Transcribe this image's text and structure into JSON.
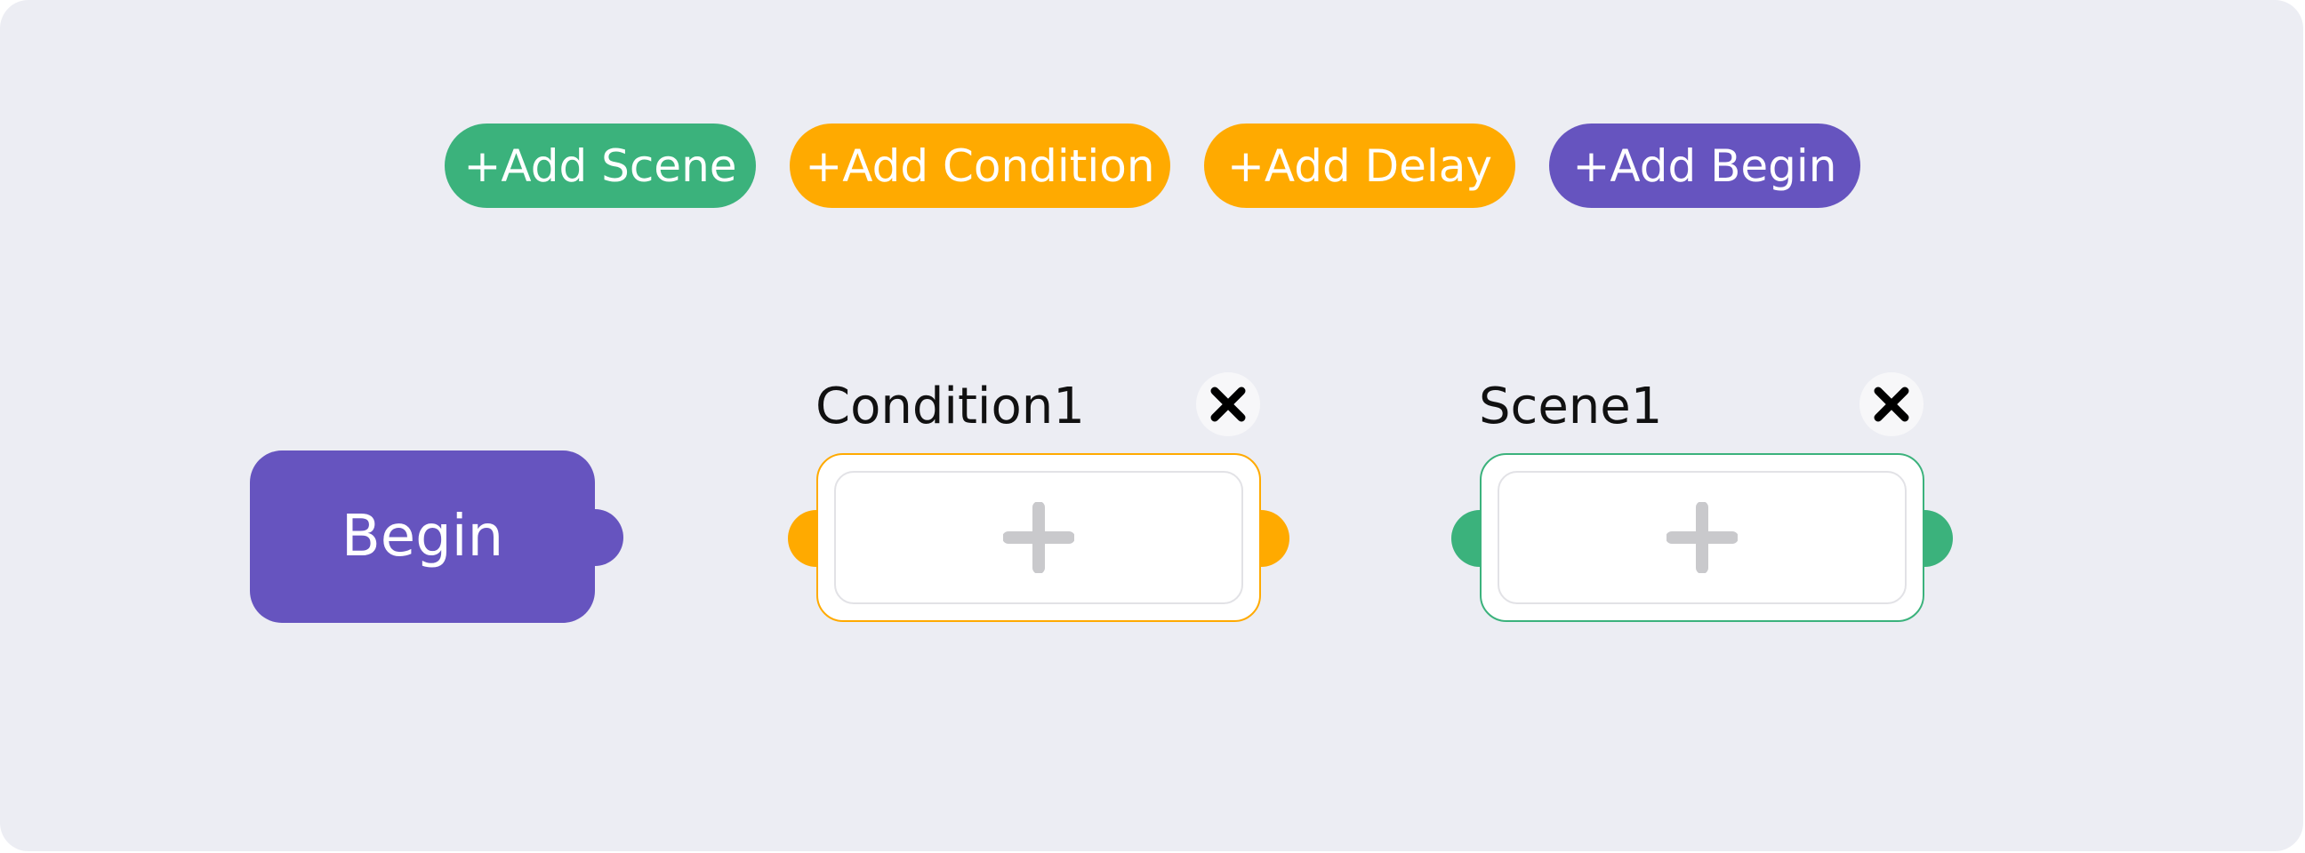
{
  "toolbar": {
    "add_scene_label": "+Add Scene",
    "add_condition_label": "+Add Condition",
    "add_delay_label": "+Add Delay",
    "add_begin_label": "+Add Begin"
  },
  "nodes": {
    "begin": {
      "label": "Begin"
    },
    "condition": {
      "title": "Condition1",
      "close_icon": "close-icon",
      "add_icon": "plus-icon"
    },
    "scene": {
      "title": "Scene1",
      "close_icon": "close-icon",
      "add_icon": "plus-icon"
    }
  },
  "colors": {
    "scene": "#3bb27c",
    "condition": "#ffaa00",
    "delay": "#ffaa00",
    "begin": "#6654bf",
    "background": "#ecedf3"
  }
}
